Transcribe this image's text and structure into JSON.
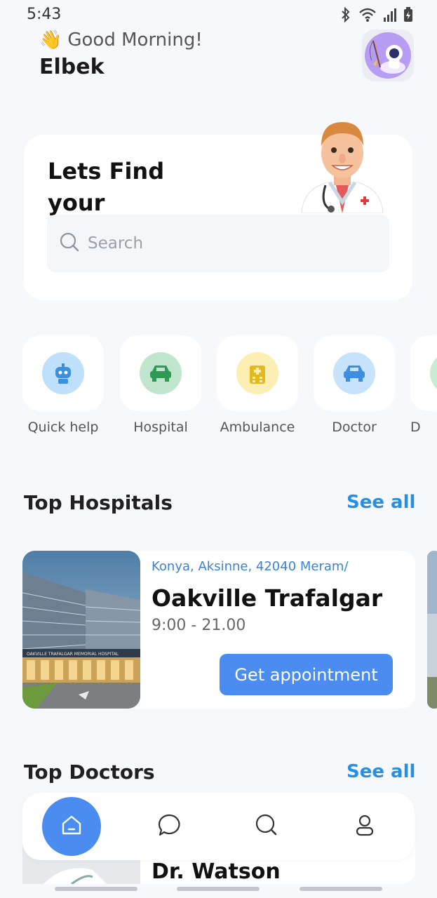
{
  "status": {
    "time": "5:43"
  },
  "header": {
    "greeting": "Good Morning!",
    "greeting_emoji": "👋",
    "username": "Elbek",
    "avatar_icon": "astronaut-avatar"
  },
  "hero": {
    "title": "Lets Find your",
    "search_placeholder": "Search"
  },
  "categories": [
    {
      "label": "Quick help",
      "icon": "robot-icon",
      "color": "#bfe0fb"
    },
    {
      "label": "Hospital",
      "icon": "car-icon",
      "color": "#bfe5cc"
    },
    {
      "label": "Ambulance",
      "icon": "hospital-building-icon",
      "color": "#fbefb4"
    },
    {
      "label": "Doctor",
      "icon": "car-icon",
      "color": "#c7e3fb"
    },
    {
      "label": "D",
      "icon": "car-icon",
      "color": "#c9ead3"
    }
  ],
  "top_hospitals": {
    "title": "Top Hospitals",
    "see_all": "See all",
    "items": [
      {
        "address": "Konya, Aksinne, 42040 Meram/",
        "name": "Oakville Trafalgar",
        "hours": "9:00 - 21.00",
        "action": "Get appointment",
        "image_sign": "OAKVILLE TRAFALGAR MEMORIAL HOSPITAL"
      }
    ]
  },
  "top_doctors": {
    "title": "Top Doctors",
    "see_all": "See all",
    "items": [
      {
        "name": "Dr. Watson"
      }
    ]
  },
  "nav": {
    "items": [
      "home-icon",
      "chat-icon",
      "search-icon",
      "profile-icon"
    ],
    "active": "home-icon"
  },
  "colors": {
    "accent": "#4a8cf0",
    "link": "#2a8fe0"
  }
}
